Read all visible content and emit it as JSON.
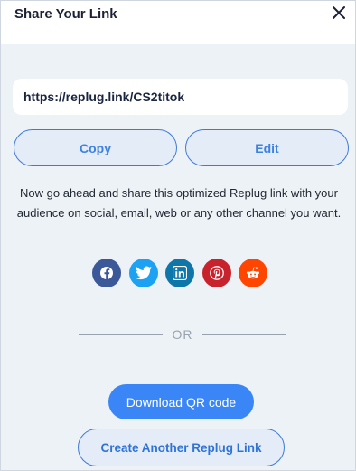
{
  "dialog": {
    "title": "Share Your Link"
  },
  "link": {
    "url": "https://replug.link/CS2titok"
  },
  "actions": {
    "copy_label": "Copy",
    "edit_label": "Edit"
  },
  "description": "Now go ahead and share this optimized Replug link with your audience on social, email, web or any other channel you want.",
  "social": [
    {
      "name": "facebook",
      "icon": "facebook-icon",
      "color": "#3b5998"
    },
    {
      "name": "twitter",
      "icon": "twitter-icon",
      "color": "#1da1f2"
    },
    {
      "name": "linkedin",
      "icon": "linkedin-icon",
      "color": "#0e76a8"
    },
    {
      "name": "pinterest",
      "icon": "pinterest-icon",
      "color": "#c8232c"
    },
    {
      "name": "reddit",
      "icon": "reddit-icon",
      "color": "#ff4500"
    }
  ],
  "divider": {
    "label": "OR"
  },
  "qr": {
    "label": "Download QR code"
  },
  "create": {
    "label": "Create Another Replug Link"
  },
  "colors": {
    "accent": "#3b86f6",
    "background": "#edf2f7"
  }
}
